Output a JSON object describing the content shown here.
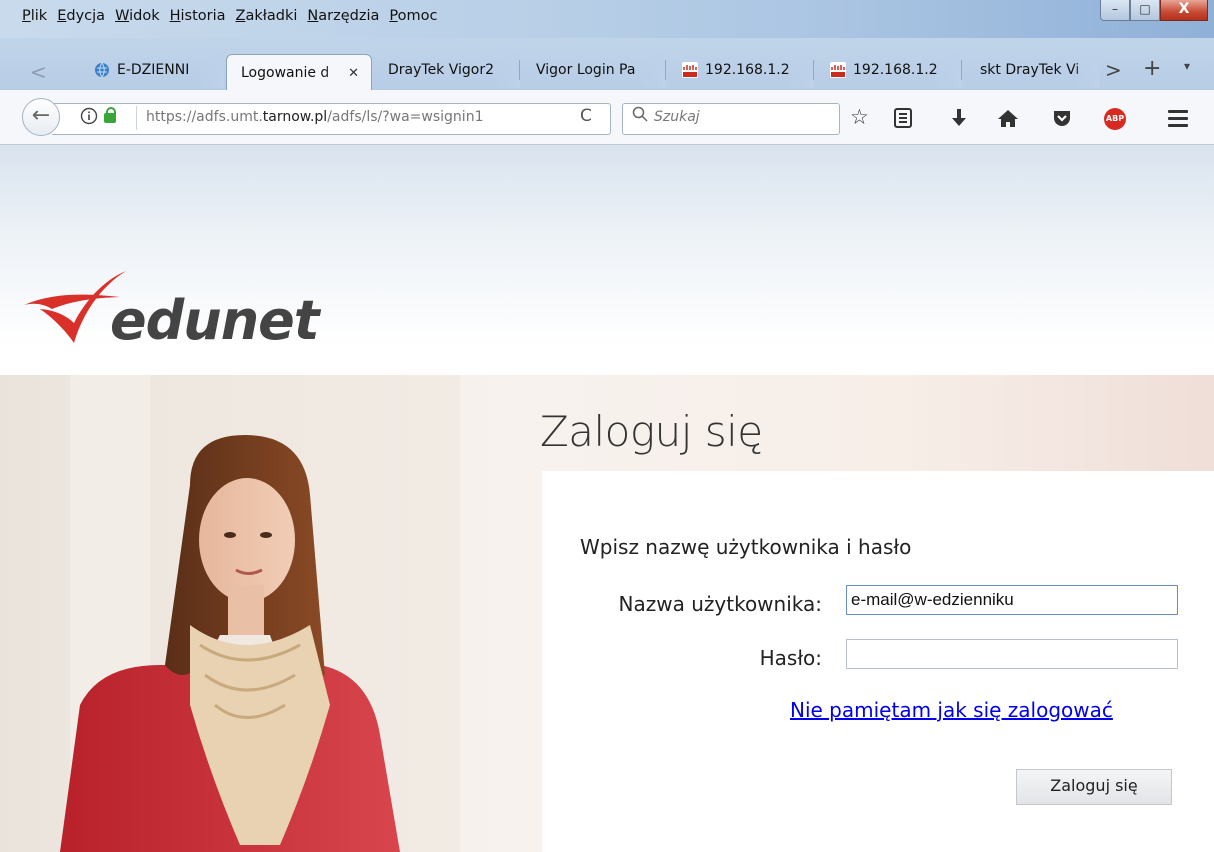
{
  "menu": [
    "Plik",
    "Edycja",
    "Widok",
    "Historia",
    "Zakładki",
    "Narzędzia",
    "Pomoc"
  ],
  "window_controls": {
    "minimize": "–",
    "maximize": "□",
    "close": "X"
  },
  "tabs": [
    {
      "label": "E-DZIENNI",
      "favicon": "globe-icon",
      "favicon_color": "#3d7fc1"
    },
    {
      "label": "Logowanie d",
      "favicon": "",
      "active": true,
      "close": "✕"
    },
    {
      "label": "DrayTek Vigor2",
      "favicon": ""
    },
    {
      "label": "Vigor Login Pa",
      "favicon": ""
    },
    {
      "label": "192.168.1.2",
      "favicon": "cisco-icon",
      "favicon_color": "#cc2a1f"
    },
    {
      "label": "192.168.1.2",
      "favicon": "cisco-icon",
      "favicon_color": "#cc2a1f"
    },
    {
      "label": "skt DrayTek Vi",
      "favicon": ""
    }
  ],
  "tab_controls": {
    "prev": "<",
    "next": ">",
    "new": "+",
    "list": "▾"
  },
  "navbar": {
    "back": "←",
    "url_prefix": "https://adfs.umt.",
    "url_domain": "tarnow.pl",
    "url_suffix": "/adfs/ls/?wa=wsignin1",
    "reload": "C",
    "search_placeholder": "Szukaj",
    "abp": "ABP"
  },
  "page": {
    "logo": "edunet",
    "title": "Zaloguj się",
    "subtitle": "Wpisz nazwę użytkownika i hasło",
    "username_label": "Nazwa użytkownika:",
    "username_value": "e-mail@w-edzienniku",
    "password_label": "Hasło:",
    "password_value": "",
    "forgot_link": "Nie pamiętam jak się zalogować",
    "submit": "Zaloguj się"
  },
  "colors": {
    "link": "#0000ee",
    "logo_red": "#d9302a",
    "abp_red": "#d92a22",
    "ssl_green": "#3aa63a"
  }
}
